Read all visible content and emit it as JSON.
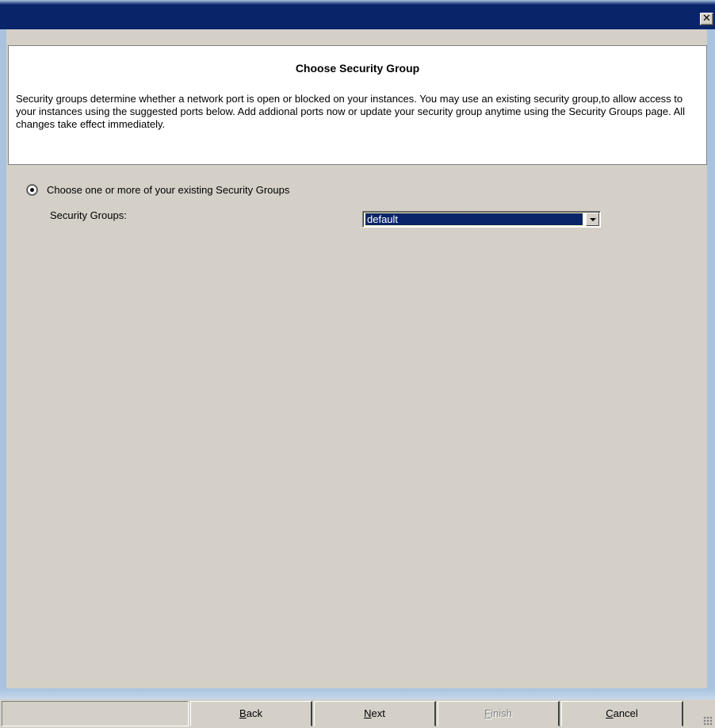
{
  "window": {
    "title": "",
    "close_glyph": "✕"
  },
  "header": {
    "title": "Choose Security Group",
    "description": "Security groups determine whether a network port is open or blocked on your instances. You may use an existing security group,to allow access to your instances using the suggested ports below. Add addional ports now or update your security group anytime using the Security Groups page. All changes take effect immediately."
  },
  "options": {
    "existing_label": "Choose one or more of your existing Security Groups",
    "existing_selected": true,
    "security_groups_label": "Security Groups:",
    "security_groups_value": "default"
  },
  "buttons": {
    "back": {
      "prefix": "",
      "accel": "B",
      "rest": "ack",
      "enabled": true
    },
    "next": {
      "prefix": "",
      "accel": "N",
      "rest": "ext",
      "enabled": true
    },
    "finish": {
      "prefix": "",
      "accel": "F",
      "rest": "inish",
      "enabled": false
    },
    "cancel": {
      "prefix": "",
      "accel": "C",
      "rest": "ancel",
      "enabled": true
    }
  },
  "colors": {
    "titlebar": "#0a246a",
    "frame": "#a9c3df",
    "dialog_bg": "#d4d0c8",
    "selection": "#0a246a"
  }
}
